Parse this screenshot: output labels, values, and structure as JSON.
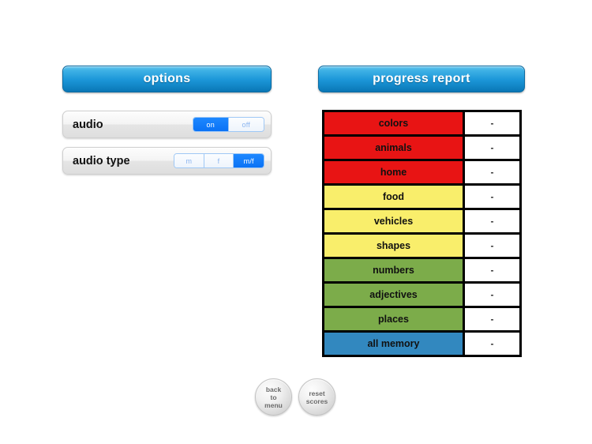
{
  "options_panel": {
    "header_label": "options",
    "rows": [
      {
        "label": "audio",
        "control": "segmented",
        "segments": [
          {
            "label": "on",
            "selected": true
          },
          {
            "label": "off",
            "selected": false
          }
        ]
      },
      {
        "label": "audio type",
        "control": "segmented",
        "segments": [
          {
            "label": "m",
            "selected": false
          },
          {
            "label": "f",
            "selected": false
          },
          {
            "label": "m/f",
            "selected": true
          }
        ]
      }
    ]
  },
  "progress_panel": {
    "header_label": "progress report",
    "rows": [
      {
        "category": "colors",
        "score": "-",
        "color": "#e81414"
      },
      {
        "category": "animals",
        "score": "-",
        "color": "#e81414"
      },
      {
        "category": "home",
        "score": "-",
        "color": "#e81414"
      },
      {
        "category": "food",
        "score": "-",
        "color": "#f9ee6b"
      },
      {
        "category": "vehicles",
        "score": "-",
        "color": "#f9ee6b"
      },
      {
        "category": "shapes",
        "score": "-",
        "color": "#f9ee6b"
      },
      {
        "category": "numbers",
        "score": "-",
        "color": "#7cac4a"
      },
      {
        "category": "adjectives",
        "score": "-",
        "color": "#7cac4a"
      },
      {
        "category": "places",
        "score": "-",
        "color": "#7cac4a"
      },
      {
        "category": "all memory",
        "score": "-",
        "color": "#3288bf"
      }
    ]
  },
  "footer": {
    "buttons": [
      {
        "name": "back-to-menu",
        "lines": [
          "back",
          "to",
          "menu"
        ]
      },
      {
        "name": "reset-scores",
        "lines": [
          "reset",
          "scores"
        ]
      }
    ]
  },
  "colors": {
    "header_blue_top": "#6ec8ee",
    "header_blue_bottom": "#0a76b4",
    "segment_selected": "#1e88ff",
    "segment_text": "#8ab4ef",
    "red": "#e81414",
    "yellow": "#f9ee6b",
    "green": "#7cac4a",
    "blue": "#3288bf",
    "table_border": "#000000",
    "panel_background": "#ffffff"
  }
}
